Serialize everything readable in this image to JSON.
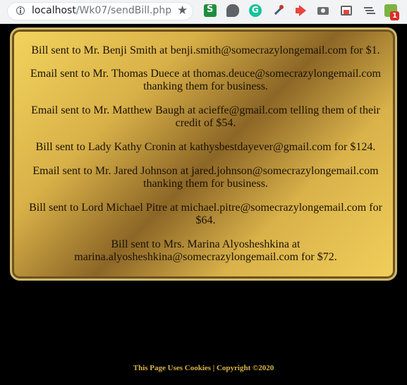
{
  "browser": {
    "url_host": "localhost",
    "url_path": "/Wk07/sendBill.php",
    "star_icon": "★",
    "extension_icons": [
      "sheets-icon",
      "speech-bubble-icon",
      "grammarly-icon",
      "color-picker-icon",
      "megaphone-icon",
      "camera-icon",
      "windows-icon",
      "list-icon",
      "notification-icon"
    ],
    "badge_count": "1"
  },
  "messages": [
    "Bill sent to Mr. Benji Smith at benji.smith@somecrazylongemail.com for $1.",
    "Email sent to Mr. Thomas Duece at thomas.deuce@somecrazylongemail.com thanking them for business.",
    "Email sent to Mr. Matthew Baugh at acieffe@gmail.com telling them of their credit of $54.",
    "Bill sent to Lady Kathy Cronin at kathysbestdayever@gmail.com for $124.",
    "Email sent to Mr. Jared Johnson at jared.johnson@somecrazylongemail.com thanking them for business.",
    "Bill sent to Lord Michael Pitre at michael.pitre@somecrazylongemail.com for $64.",
    "Bill sent to Mrs. Marina Alyosheshkina at marina.alyosheshkina@somecrazylongemail.com for $72."
  ],
  "footer": {
    "text": "This Page Uses Cookies | Copyright ©2020"
  },
  "colors": {
    "page_background": "#000000",
    "panel_gold": "#d8b048",
    "panel_dark_gold": "#8c6626",
    "footer_text": "#d9b548"
  }
}
